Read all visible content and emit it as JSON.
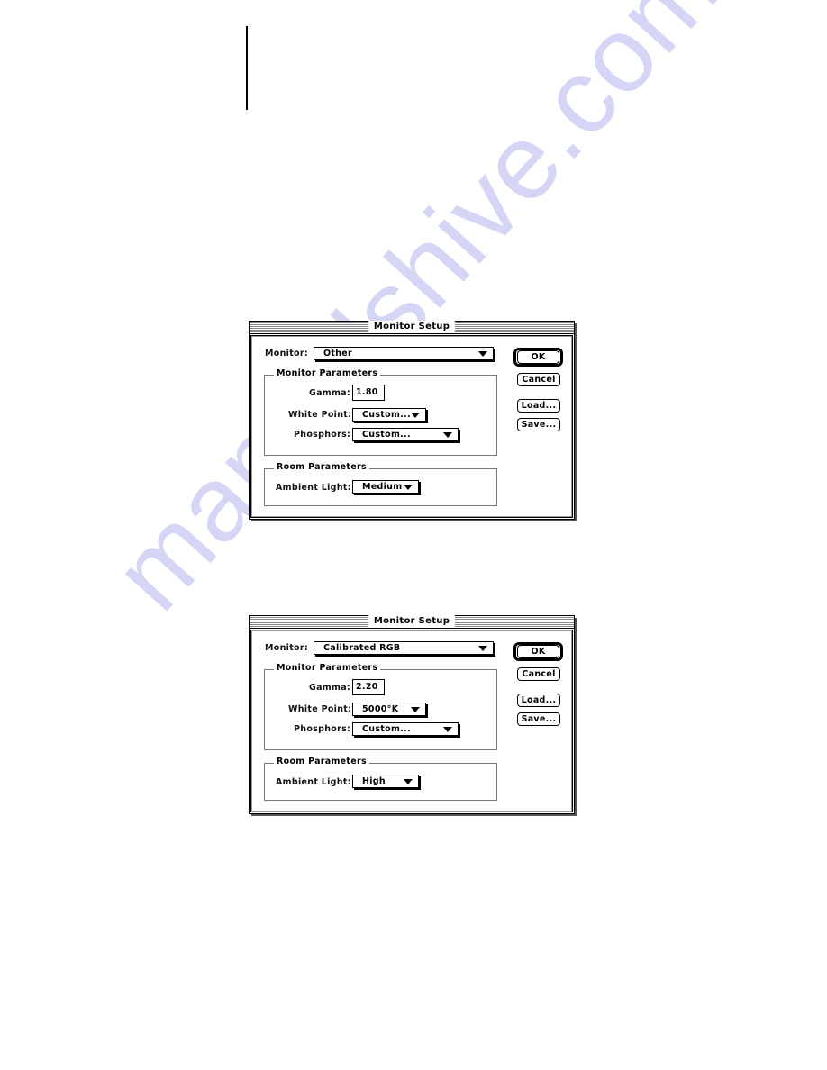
{
  "watermark": "manualshive.com",
  "dialogs": [
    {
      "title": "Monitor Setup",
      "monitor_label": "Monitor:",
      "monitor_value": "Other",
      "monitor_params_legend": "Monitor Parameters",
      "gamma_label": "Gamma:",
      "gamma_value": "1.80",
      "white_point_label": "White Point:",
      "white_point_value": "Custom...",
      "phosphors_label": "Phosphors:",
      "phosphors_value": "Custom...",
      "room_params_legend": "Room Parameters",
      "ambient_light_label": "Ambient Light:",
      "ambient_light_value": "Medium",
      "buttons": {
        "ok": "OK",
        "cancel": "Cancel",
        "load": "Load...",
        "save": "Save..."
      }
    },
    {
      "title": "Monitor Setup",
      "monitor_label": "Monitor:",
      "monitor_value": "Calibrated RGB",
      "monitor_params_legend": "Monitor Parameters",
      "gamma_label": "Gamma:",
      "gamma_value": "2.20",
      "white_point_label": "White Point:",
      "white_point_value": "5000°K",
      "phosphors_label": "Phosphors:",
      "phosphors_value": "Custom...",
      "room_params_legend": "Room Parameters",
      "ambient_light_label": "Ambient Light:",
      "ambient_light_value": "High",
      "buttons": {
        "ok": "OK",
        "cancel": "Cancel",
        "load": "Load...",
        "save": "Save..."
      }
    }
  ]
}
